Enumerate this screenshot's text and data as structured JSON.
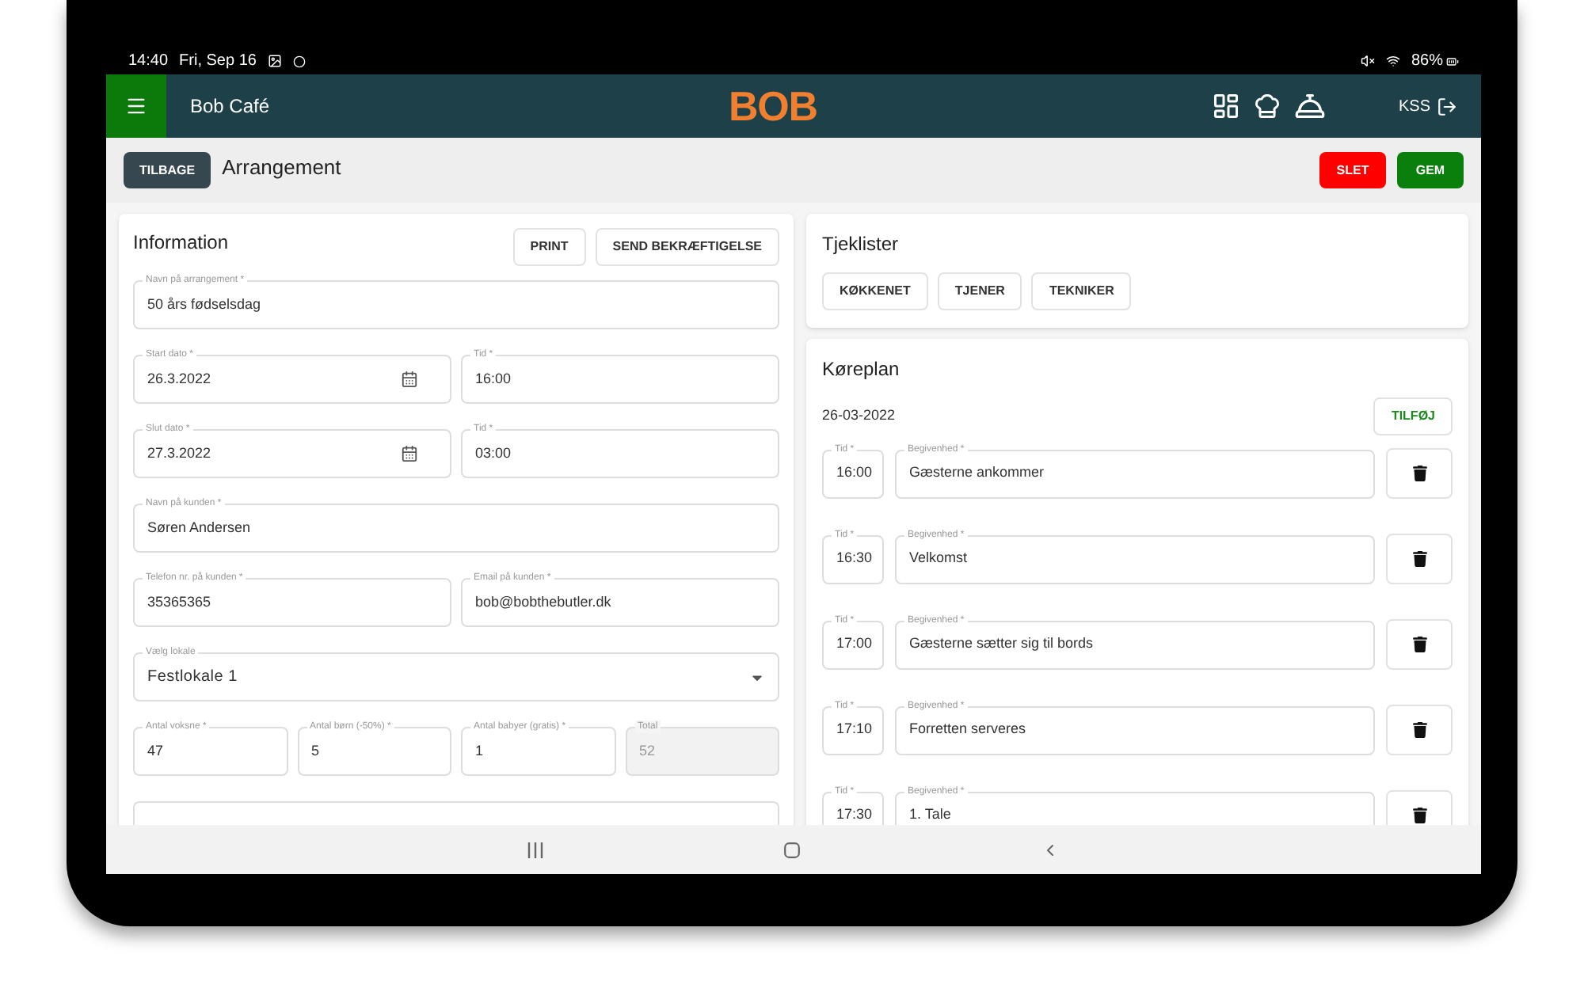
{
  "status_bar": {
    "time": "14:40",
    "date": "Fri, Sep 16",
    "battery": "86%"
  },
  "header": {
    "title": "Bob Café",
    "logo": "BOB",
    "user": "KSS"
  },
  "toolbar": {
    "back": "TILBAGE",
    "title": "Arrangement",
    "buttons": [
      {
        "label": "SLET",
        "kind": "danger"
      },
      {
        "label": "GEM",
        "kind": "primary"
      }
    ]
  },
  "information": {
    "title": "Information",
    "buttons": [
      "PRINT",
      "SEND BEKRÆFTIGELSE"
    ],
    "rows": [
      [
        {
          "kind": "text",
          "label": "Navn på arrangement *",
          "value": "50 års fødselsdag"
        }
      ],
      [
        {
          "kind": "date",
          "label": "Start dato *",
          "value": "26.3.2022"
        },
        {
          "kind": "text",
          "label": "Tid *",
          "value": "16:00"
        }
      ],
      [
        {
          "kind": "date",
          "label": "Slut dato *",
          "value": "27.3.2022"
        },
        {
          "kind": "text",
          "label": "Tid *",
          "value": "03:00"
        }
      ],
      [
        {
          "kind": "text",
          "label": "Navn på kunden *",
          "value": "Søren Andersen"
        }
      ],
      [
        {
          "kind": "text",
          "label": "Telefon nr. på kunden *",
          "value": "35365365"
        },
        {
          "kind": "text",
          "label": "Email på kunden *",
          "value": "bob@bobthebutler.dk"
        }
      ],
      [
        {
          "kind": "select",
          "label": "Vælg lokale",
          "value": "Festlokale 1"
        }
      ],
      [
        {
          "kind": "text",
          "label": "Antal voksne *",
          "value": "47"
        },
        {
          "kind": "text",
          "label": "Antal børn (-50%) *",
          "value": "5"
        },
        {
          "kind": "text",
          "label": "Antal babyer (gratis) *",
          "value": "1"
        },
        {
          "kind": "readonly",
          "label": "Total",
          "value": "52"
        }
      ],
      [
        {
          "kind": "text"
        }
      ]
    ]
  },
  "checklists": {
    "title": "Tjeklister",
    "buttons": [
      "KØKKENET",
      "TJENER",
      "TEKNIKER"
    ]
  },
  "schedule": {
    "title": "Køreplan",
    "date": "26-03-2022",
    "add": "TILFØJ",
    "entries": [
      {
        "time_label": "Tid *",
        "time": "16:00",
        "event_label": "Begivenhed *",
        "event": "Gæsterne ankommer"
      },
      {
        "time_label": "Tid *",
        "time": "16:30",
        "event_label": "Begivenhed *",
        "event": "Velkomst"
      },
      {
        "time_label": "Tid *",
        "time": "17:00",
        "event_label": "Begivenhed *",
        "event": "Gæsterne sætter sig til bords"
      },
      {
        "time_label": "Tid *",
        "time": "17:10",
        "event_label": "Begivenhed *",
        "event": "Forretten serveres"
      },
      {
        "time_label": "Tid *",
        "time": "17:30",
        "event_label": "Begivenhed *",
        "event": "1. Tale"
      }
    ]
  }
}
